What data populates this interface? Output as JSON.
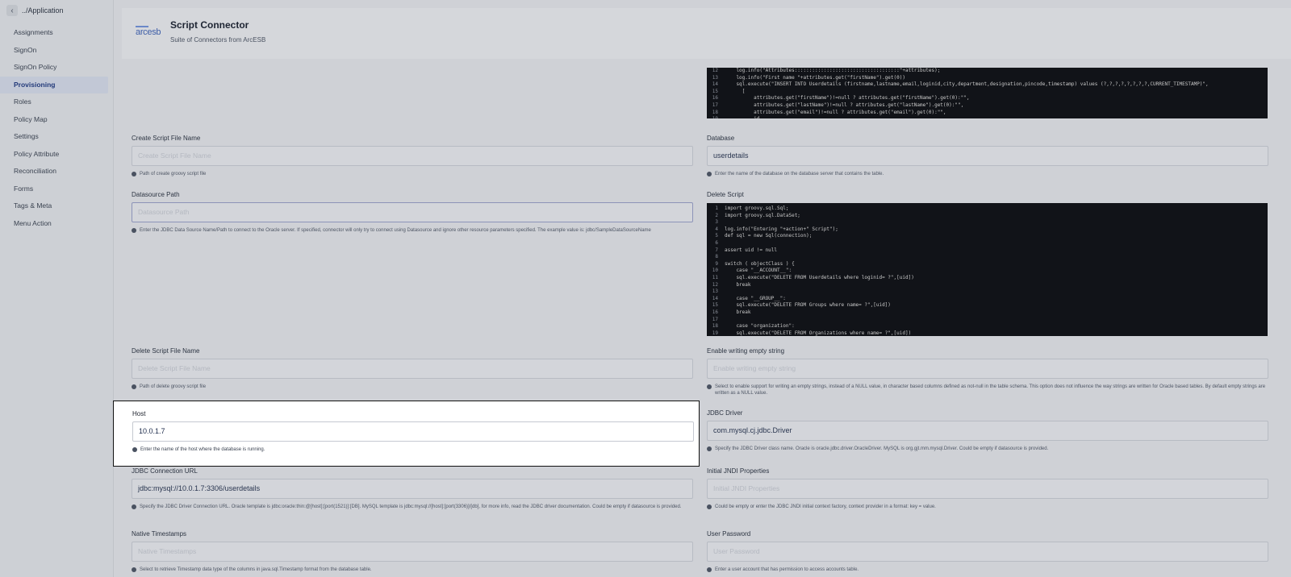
{
  "sidebar": {
    "back_label": "../Application",
    "items": [
      {
        "label": "Assignments"
      },
      {
        "label": "SignOn"
      },
      {
        "label": "SignOn Policy"
      },
      {
        "label": "Provisioning",
        "active": true
      },
      {
        "label": "Roles"
      },
      {
        "label": "Policy Map"
      },
      {
        "label": "Settings"
      },
      {
        "label": "Policy Attribute"
      },
      {
        "label": "Reconciliation"
      },
      {
        "label": "Forms"
      },
      {
        "label": "Tags & Meta"
      },
      {
        "label": "Menu Action"
      }
    ]
  },
  "header": {
    "logo_text": "arcesb",
    "title": "Script Connector",
    "subtitle": "Suite of Connectors from ArcESB"
  },
  "fields": {
    "create_script_file_name": {
      "label": "Create Script File Name",
      "placeholder": "Create Script File Name",
      "hint": "Path of create groovy script file"
    },
    "database": {
      "label": "Database",
      "value": "userdetails",
      "hint": "Enter the name of the database on the database server that contains the table."
    },
    "datasource_path": {
      "label": "Datasource Path",
      "placeholder": "Datasource Path",
      "hint": "Enter the JDBC Data Source Name/Path to connect to the Oracle server. If specified, connector will only try to connect using Datasource and ignore other resource parameters specified. The example value is: jdbc/SampleDataSourceName"
    },
    "delete_script": {
      "label": "Delete Script"
    },
    "delete_script_file_name": {
      "label": "Delete Script File Name",
      "placeholder": "Delete Script File Name",
      "hint": "Path of delete groovy script file"
    },
    "enable_writing_empty_string": {
      "label": "Enable writing empty string",
      "placeholder": "Enable writing empty string",
      "hint": "Select to enable support for writing an empty strings, instead of a NULL value, in character based columns defined as not-null in the table schema. This option does not influence the way strings are written for Oracle based tables. By default empty strings are written as a NULL value."
    },
    "host": {
      "label": "Host",
      "value": "10.0.1.7",
      "hint": "Enter the name of the host where the database is running."
    },
    "jdbc_driver": {
      "label": "JDBC Driver",
      "value": "com.mysql.cj.jdbc.Driver",
      "hint": "Specify the JDBC Driver class name. Oracle is oracle.jdbc.driver.OracleDriver. MySQL is org.gjt.mm.mysql.Driver. Could be empty if datasource is provided."
    },
    "jdbc_connection_url": {
      "label": "JDBC Connection URL",
      "value": "jdbc:mysql://10.0.1.7:3306/userdetails",
      "hint": "Specify the JDBC Driver Connection URL. Oracle template is jdbc:oracle:thin:@[host]:[port(1521)]:[DB]. MySQL template is jdbc:mysql://[host]:[port(3306)]/[db], for more info, read the JDBC driver documentation. Could be empty if datasource is provided."
    },
    "initial_jndi_properties": {
      "label": "Initial JNDI Properties",
      "placeholder": "Initial JNDI Properties",
      "hint": "Could be empty or enter the JDBC JNDI initial context factory, context provider in a format: key = value."
    },
    "native_timestamps": {
      "label": "Native Timestamps",
      "placeholder": "Native Timestamps",
      "hint": "Select to retrieve Timestamp data type of the columns in java.sql.Timestamp format from the database table."
    },
    "user_password": {
      "label": "User Password",
      "placeholder": "User Password",
      "hint": "Enter a user account that has permission to access accounts table."
    }
  },
  "create_script_code": [
    {
      "n": "12",
      "t": "    log.info(\"Attributes::::::::::::::::::::::::::::::::::::\"+attributes);"
    },
    {
      "n": "13",
      "t": "    log.info(\"First name \"+attributes.get(\"firstName\").get(0))"
    },
    {
      "n": "14",
      "t": "    sql.execute(\"INSERT INTO Userdetails (firstname,lastname,email,loginid,city,department,designation,pincode,timestamp) values (?,?,?,?,?,?,?,?,CURRENT_TIMESTAMP)\","
    },
    {
      "n": "15",
      "t": "      ["
    },
    {
      "n": "16",
      "t": "          attributes.get(\"firstName\")!=null ? attributes.get(\"firstName\").get(0):\"\","
    },
    {
      "n": "17",
      "t": "          attributes.get(\"lastName\")!=null ? attributes.get(\"lastName\").get(0):\"\","
    },
    {
      "n": "18",
      "t": "          attributes.get(\"email\")!=null ? attributes.get(\"email\").get(0):\"\","
    },
    {
      "n": "19",
      "t": "          id"
    }
  ],
  "delete_script_code": [
    {
      "n": "1",
      "t": "import groovy.sql.Sql;"
    },
    {
      "n": "2",
      "t": "import groovy.sql.DataSet;"
    },
    {
      "n": "3",
      "t": ""
    },
    {
      "n": "4",
      "t": "log.info(\"Entering \"+action+\" Script\");"
    },
    {
      "n": "5",
      "t": "def sql = new Sql(connection);"
    },
    {
      "n": "6",
      "t": ""
    },
    {
      "n": "7",
      "t": "assert uid != null"
    },
    {
      "n": "8",
      "t": ""
    },
    {
      "n": "9",
      "t": "switch ( objectClass ) {"
    },
    {
      "n": "10",
      "t": "    case \"__ACCOUNT__\":"
    },
    {
      "n": "11",
      "t": "    sql.execute(\"DELETE FROM Userdetails where loginid= ?\",[uid])"
    },
    {
      "n": "12",
      "t": "    break"
    },
    {
      "n": "13",
      "t": ""
    },
    {
      "n": "14",
      "t": "    case \"__GROUP__\":"
    },
    {
      "n": "15",
      "t": "    sql.execute(\"DELETE FROM Groups where name= ?\",[uid])"
    },
    {
      "n": "16",
      "t": "    break"
    },
    {
      "n": "17",
      "t": ""
    },
    {
      "n": "18",
      "t": "    case \"organization\":"
    },
    {
      "n": "19",
      "t": "    sql.execute(\"DELETE FROM Organizations where name= ?\",[uid])"
    }
  ]
}
